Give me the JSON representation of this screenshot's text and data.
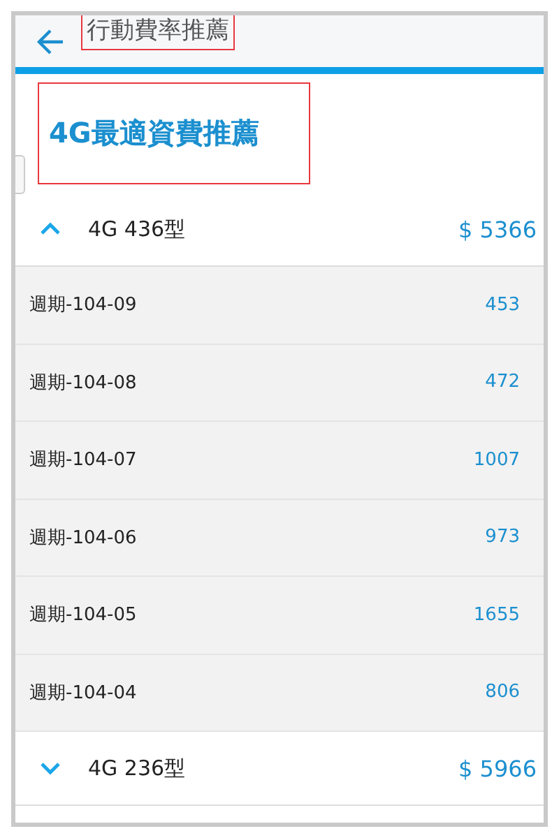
{
  "app_bar": {
    "title": "行動費率推薦",
    "highlighted": true
  },
  "heading": {
    "text": "4G最適資費推薦",
    "highlighted": true
  },
  "plans": [
    {
      "name": "4G 436型",
      "price": "$ 5366",
      "expanded": true,
      "periods": [
        {
          "label": "週期-104-09",
          "amount": "453"
        },
        {
          "label": "週期-104-08",
          "amount": "472"
        },
        {
          "label": "週期-104-07",
          "amount": "1007"
        },
        {
          "label": "週期-104-06",
          "amount": "973"
        },
        {
          "label": "週期-104-05",
          "amount": "1655"
        },
        {
          "label": "週期-104-04",
          "amount": "806"
        }
      ]
    },
    {
      "name": "4G 236型",
      "price": "$ 5966",
      "expanded": false
    }
  ]
}
